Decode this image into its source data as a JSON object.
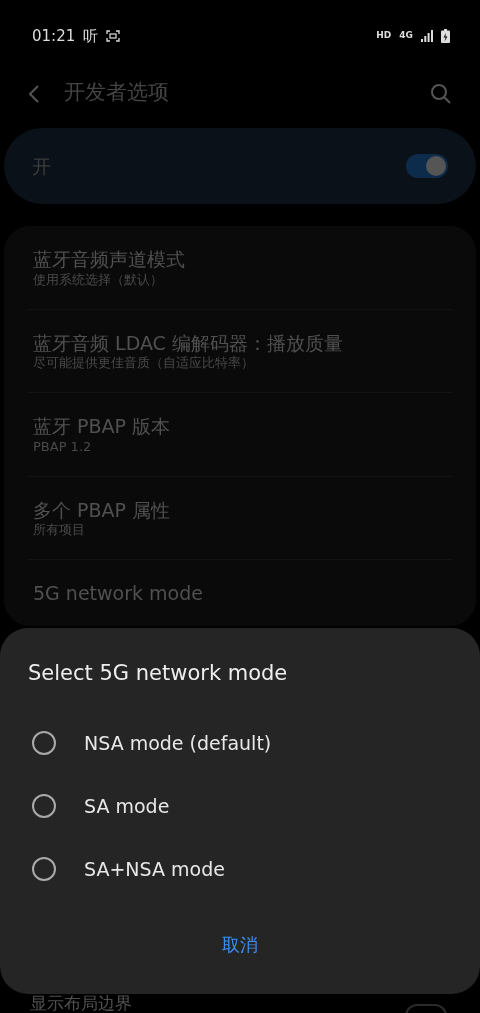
{
  "status_bar": {
    "time": "01:21",
    "app_glyph": "听",
    "hd": "HD",
    "network": "4G"
  },
  "header": {
    "title": "开发者选项"
  },
  "master_switch": {
    "label": "开",
    "on": true
  },
  "settings": [
    {
      "title": "蓝牙音频声道模式",
      "summary": "使用系统选择（默认）"
    },
    {
      "title": "蓝牙音频 LDAC 编解码器：播放质量",
      "summary": "尽可能提供更佳音质（自适应比特率）"
    },
    {
      "title": "蓝牙 PBAP 版本",
      "summary": "PBAP 1.2"
    },
    {
      "title": "多个 PBAP 属性",
      "summary": "所有项目"
    },
    {
      "title": "5G network mode"
    }
  ],
  "below_dialog": {
    "label": "显示布局边界",
    "on": false
  },
  "dialog": {
    "title": "Select 5G network mode",
    "options": [
      {
        "label": "NSA mode (default)",
        "selected": false
      },
      {
        "label": "SA mode",
        "selected": false
      },
      {
        "label": "SA+NSA mode",
        "selected": false
      }
    ],
    "cancel": "取消"
  }
}
